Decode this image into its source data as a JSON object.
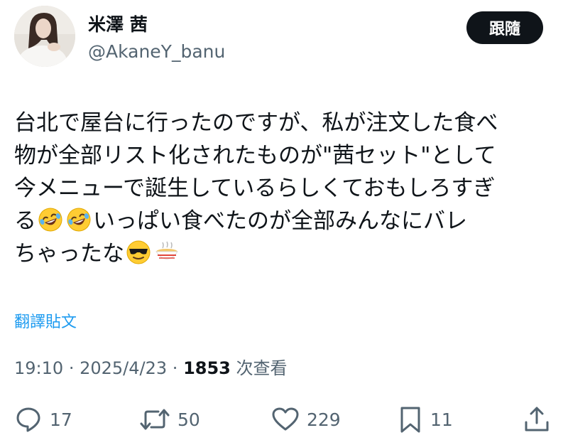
{
  "user": {
    "name": "米澤 茜",
    "handle": "@AkaneY_banu"
  },
  "follow_label": "跟隨",
  "tweet": {
    "lines": [
      "台北で屋台に行ったのですが、私が注文した食べ",
      "物が全部リスト化されたものが\"茜セット\"として",
      "今メニューで誕生しているらしくておもしろすぎ"
    ],
    "line4_before": "る",
    "line4_after": "いっぱい食べたのが全部みんなにバレ",
    "line5": "ちゃったな",
    "emojis": [
      "rofl-emoji",
      "rofl-emoji",
      "sunglasses-emoji",
      "noodle-bowl-emoji"
    ]
  },
  "translate_label": "翻譯貼文",
  "meta": {
    "time": "19:10",
    "separator": "·",
    "date": "2025/4/23",
    "views_count": "1853",
    "views_label": "次查看"
  },
  "actions": {
    "replies": "17",
    "retweets": "50",
    "likes": "229",
    "bookmarks": "11"
  },
  "icons": {
    "reply": "speech-bubble-icon",
    "retweet": "retweet-arrows-icon",
    "like": "heart-icon",
    "bookmark": "bookmark-icon",
    "share": "share-upload-icon"
  },
  "colors": {
    "text": "#0f1419",
    "secondary": "#536471",
    "link": "#1d9bf0",
    "button_bg": "#0f1419",
    "button_text": "#ffffff"
  }
}
